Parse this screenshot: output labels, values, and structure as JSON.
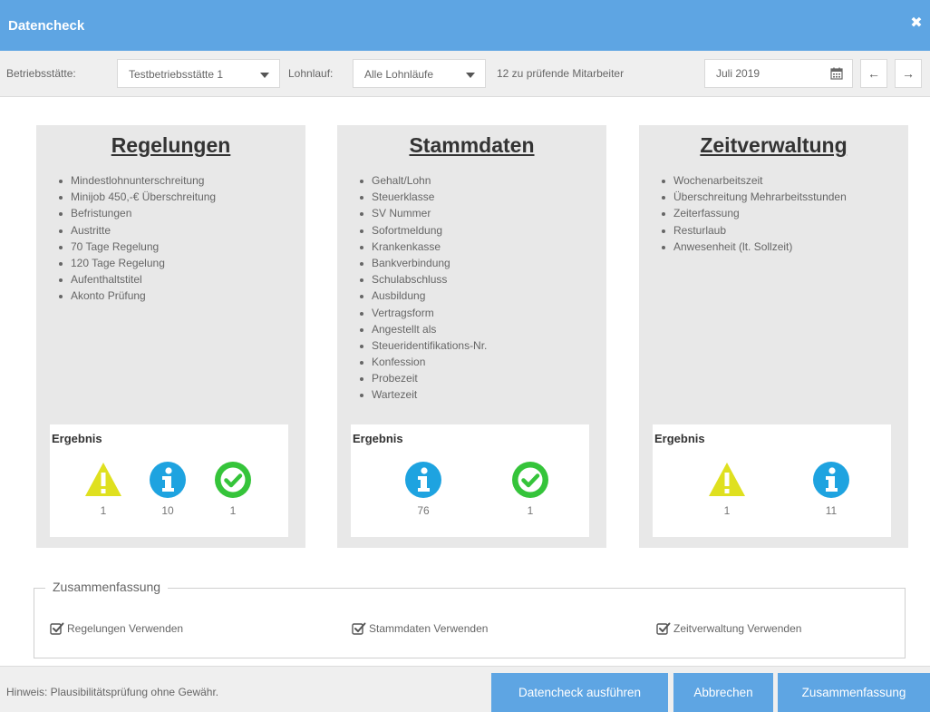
{
  "window": {
    "title": "Datencheck",
    "close_icon": "close-icon"
  },
  "toolbar": {
    "betriebsstaette_label": "Betriebsstätte:",
    "betriebsstaette_value": "Testbetriebsstätte 1",
    "lohnlauf_label": "Lohnlauf:",
    "lohnlauf_value": "Alle Lohnläufe",
    "employee_count_text": "12 zu prüfende Mitarbeiter",
    "date_value": "Juli 2019",
    "prev_icon": "arrow-left-icon",
    "next_icon": "arrow-right-icon",
    "prev_label": "←",
    "next_label": "→"
  },
  "panels": [
    {
      "title": "Regelungen",
      "items": [
        "Mindestlohnunterschreitung",
        "Minijob 450,-€ Überschreitung",
        "Befristungen",
        "Austritte",
        "70 Tage Regelung",
        "120 Tage Regelung",
        "Aufenthaltstitel",
        "Akonto Prüfung"
      ],
      "result_title": "Ergebnis",
      "results": [
        {
          "type": "warning",
          "count": "1"
        },
        {
          "type": "info",
          "count": "10"
        },
        {
          "type": "ok",
          "count": "1"
        }
      ]
    },
    {
      "title": "Stammdaten",
      "items": [
        "Gehalt/Lohn",
        "Steuerklasse",
        "SV Nummer",
        "Sofortmeldung",
        "Krankenkasse",
        "Bankverbindung",
        "Schulabschluss",
        "Ausbildung",
        "Vertragsform",
        "Angestellt als",
        "Steueridentifikations-Nr.",
        "Konfession",
        "Probezeit",
        "Wartezeit"
      ],
      "result_title": "Ergebnis",
      "results": [
        {
          "type": "info",
          "count": "76"
        },
        {
          "type": "ok",
          "count": "1"
        }
      ]
    },
    {
      "title": "Zeitverwaltung",
      "items": [
        "Wochenarbeitszeit",
        "Überschreitung Mehrarbeitsstunden",
        "Zeiterfassung",
        "Resturlaub",
        "Anwesenheit (lt. Sollzeit)"
      ],
      "result_title": "Ergebnis",
      "results": [
        {
          "type": "warning",
          "count": "1"
        },
        {
          "type": "info",
          "count": "11"
        }
      ]
    }
  ],
  "summary": {
    "legend": "Zusammenfassung",
    "checkboxes": [
      {
        "label": "Regelungen Verwenden",
        "checked": true
      },
      {
        "label": "Stammdaten Verwenden",
        "checked": true
      },
      {
        "label": "Zeitverwaltung Verwenden",
        "checked": true
      }
    ]
  },
  "footer": {
    "hint": "Hinweis: Plausibilitätsprüfung ohne Gewähr.",
    "run_button": "Datencheck ausführen",
    "cancel_button": "Abbrechen",
    "summary_button": "Zusammenfassung"
  },
  "colors": {
    "accent": "#5ea5e3",
    "warning": "#dfe01f",
    "info": "#1ea3e0",
    "ok": "#35c43a"
  }
}
